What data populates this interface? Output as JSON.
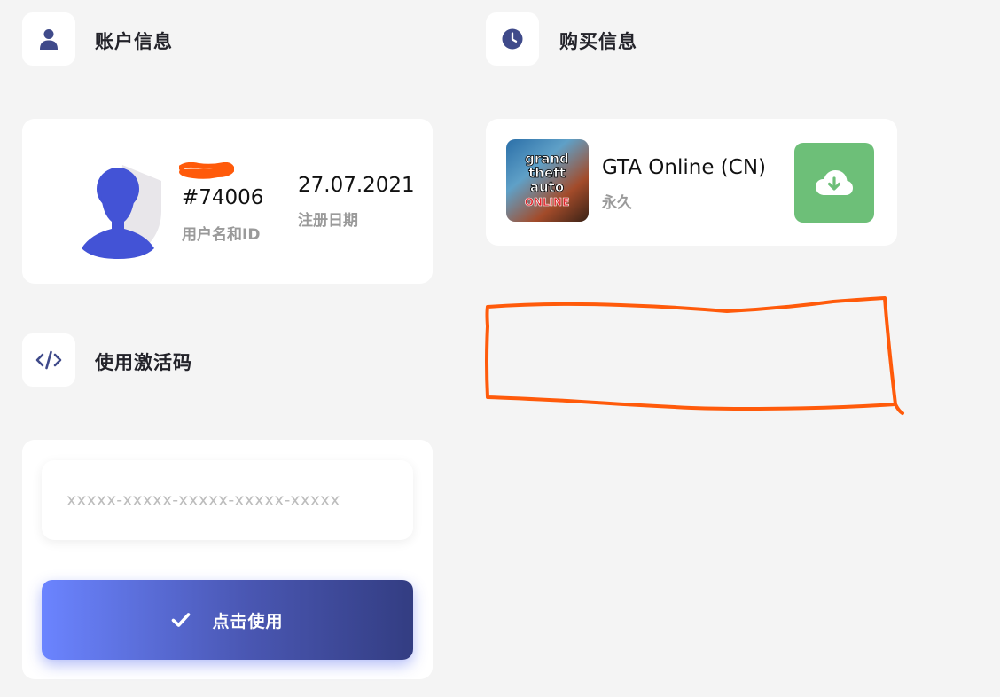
{
  "account_section": {
    "title": "账户信息",
    "icon": "user-icon"
  },
  "purchase_section": {
    "title": "购买信息",
    "icon": "clock-icon"
  },
  "activation_section": {
    "title": "使用激活码",
    "icon": "code-icon"
  },
  "account": {
    "user_id": "#74006",
    "user_id_label": "用户名和ID",
    "register_date": "27.07.2021",
    "register_date_label": "注册日期",
    "avatar": "user-silhouette-avatar"
  },
  "purchase": {
    "cover_text": [
      "grand",
      "theft",
      "auto",
      "ONLINE"
    ],
    "game_title": "GTA Online (CN)",
    "duration": "永久",
    "download_icon": "cloud-download-icon"
  },
  "activation": {
    "code_placeholder": "xxxxx-xxxxx-xxxxx-xxxxx-xxxxx",
    "code_value": "",
    "submit_label": "点击使用",
    "submit_icon": "check-icon"
  },
  "colors": {
    "accent": "#3f4a8a",
    "download_green": "#6dbf78",
    "annotation_orange": "#ff5a0a",
    "avatar_blue": "#4353d6"
  }
}
